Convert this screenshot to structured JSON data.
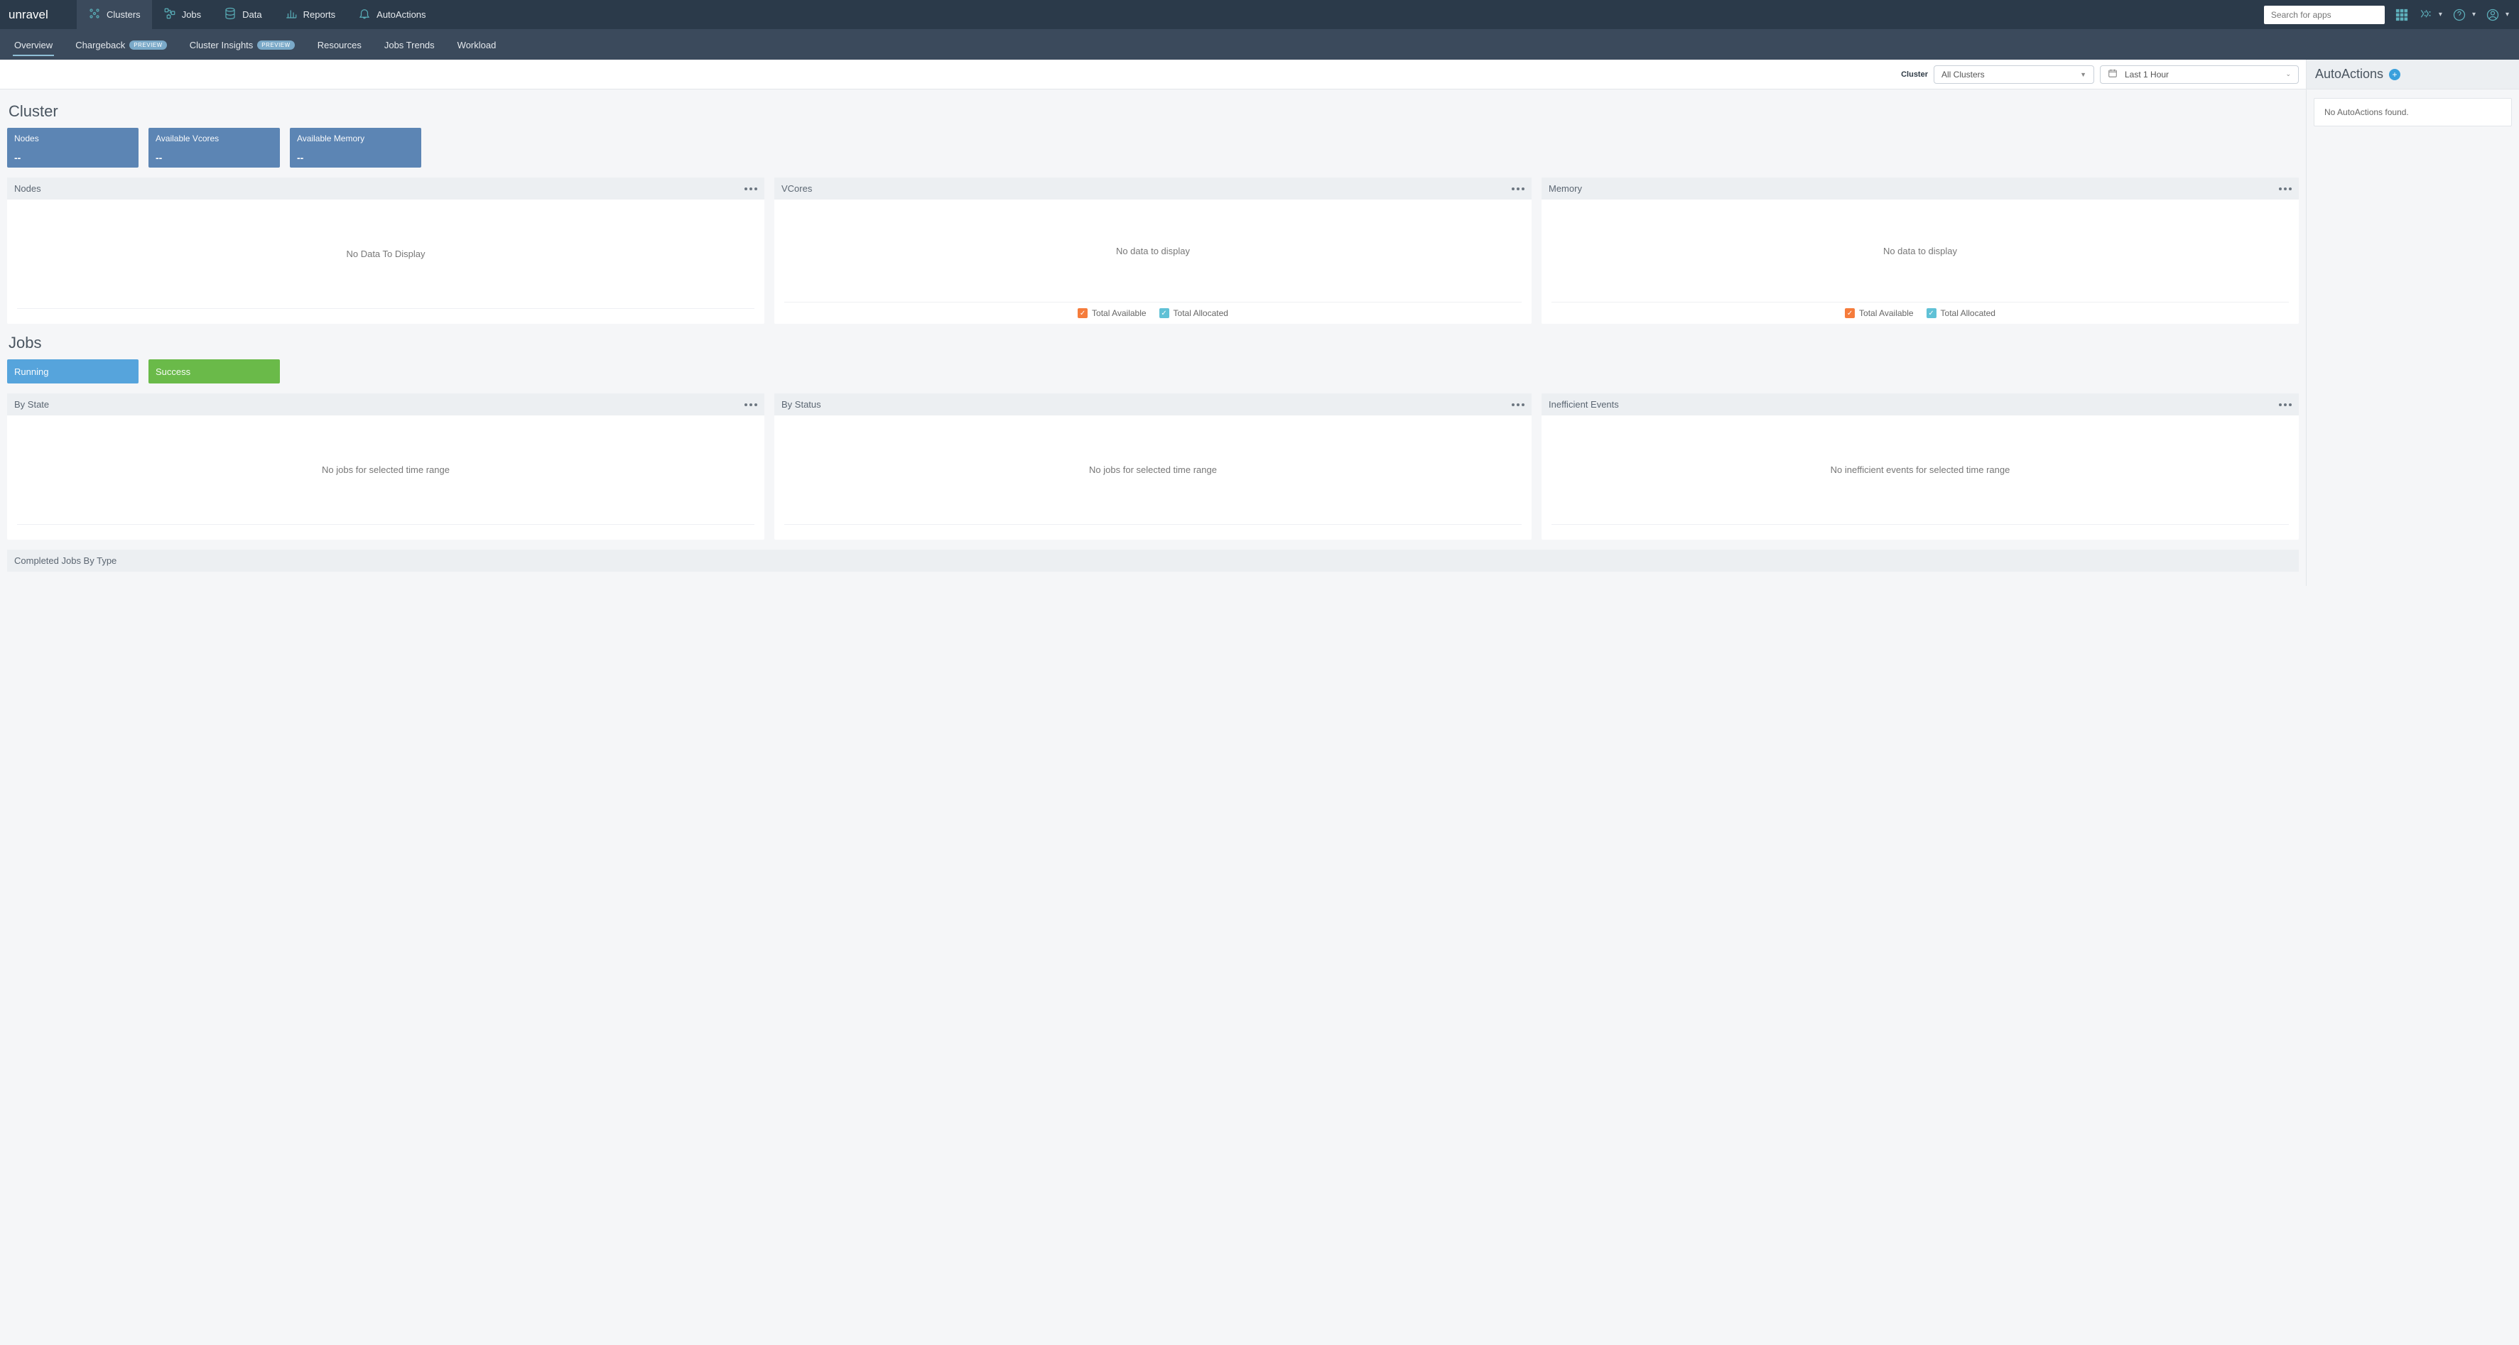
{
  "brand": "unravel",
  "topnav": {
    "items": [
      {
        "label": "Clusters"
      },
      {
        "label": "Jobs"
      },
      {
        "label": "Data"
      },
      {
        "label": "Reports"
      },
      {
        "label": "AutoActions"
      }
    ],
    "search_placeholder": "Search for apps"
  },
  "subnav": {
    "items": [
      {
        "label": "Overview",
        "active": true
      },
      {
        "label": "Chargeback",
        "preview": true
      },
      {
        "label": "Cluster Insights",
        "preview": true
      },
      {
        "label": "Resources"
      },
      {
        "label": "Jobs Trends"
      },
      {
        "label": "Workload"
      }
    ],
    "preview_badge": "PREVIEW"
  },
  "filters": {
    "cluster_label": "Cluster",
    "cluster_value": "All Clusters",
    "time_value": "Last 1 Hour"
  },
  "cluster_section": {
    "title": "Cluster",
    "tiles": [
      {
        "label": "Nodes",
        "value": "--"
      },
      {
        "label": "Available Vcores",
        "value": "--"
      },
      {
        "label": "Available Memory",
        "value": "--"
      }
    ],
    "panels": [
      {
        "title": "Nodes",
        "empty": "No Data To Display",
        "legend": false
      },
      {
        "title": "VCores",
        "empty": "No data to display",
        "legend": true
      },
      {
        "title": "Memory",
        "empty": "No data to display",
        "legend": true
      }
    ],
    "legend": {
      "available": "Total Available",
      "allocated": "Total Allocated"
    }
  },
  "jobs_section": {
    "title": "Jobs",
    "tiles": [
      {
        "label": "Running",
        "tone": "lightblue"
      },
      {
        "label": "Success",
        "tone": "green"
      }
    ],
    "panels": [
      {
        "title": "By State",
        "empty": "No jobs for selected time range"
      },
      {
        "title": "By Status",
        "empty": "No jobs for selected time range"
      },
      {
        "title": "Inefficient Events",
        "empty": "No inefficient events for selected time range"
      }
    ],
    "completed_title": "Completed Jobs By Type"
  },
  "side": {
    "title": "AutoActions",
    "empty": "No AutoActions found."
  }
}
